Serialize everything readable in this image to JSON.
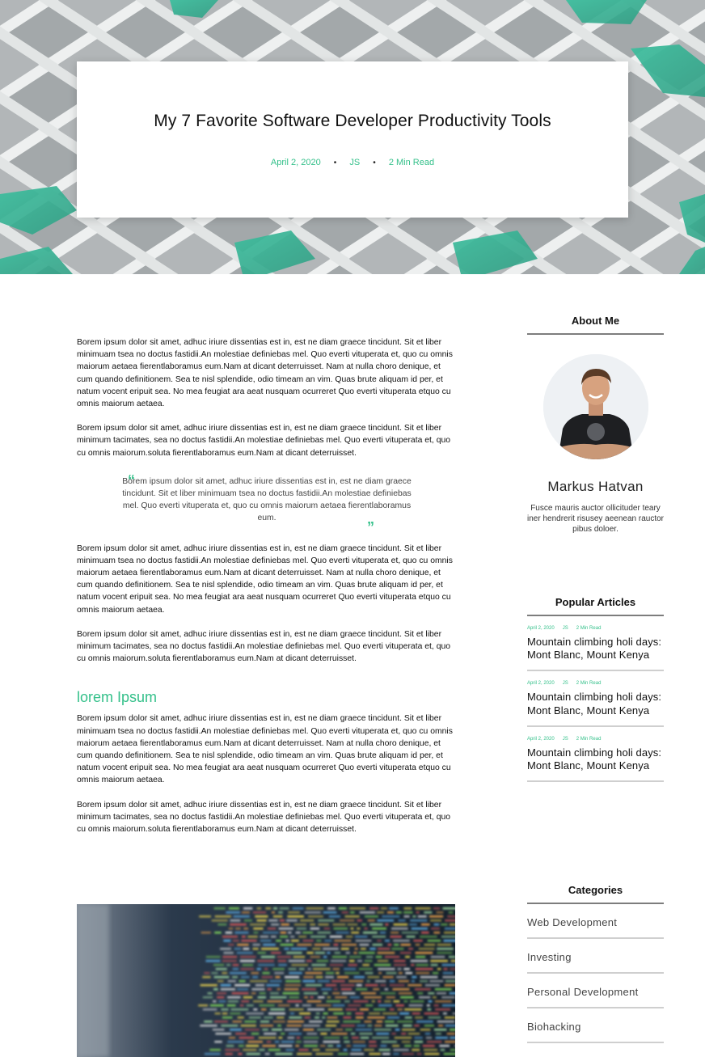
{
  "hero": {
    "title": "My 7 Favorite Software Developer Productivity Tools",
    "date": "April 2, 2020",
    "tag": "JS",
    "read_time": "2 Min Read",
    "separator": "•"
  },
  "content": {
    "paragraphs_a": [
      "Borem ipsum dolor sit amet, adhuc iriure dissentias est in, est ne diam graece tincidunt. Sit et liber minimuam tsea no doctus fastidii.An molestiae definiebas mel. Quo everti vituperata et, quo cu omnis maiorum aetaea fierentlaboramus eum.Nam at dicant deterruisset. Nam at nulla choro denique, et cum quando definitionem. Sea te nisl splendide, odio timeam an vim. Quas brute aliquam id per, et natum vocent eripuit sea. No mea feugiat ara aeat nusquam ocurreret Quo everti vituperata etquo cu omnis maiorum aetaea.",
      "Borem ipsum dolor sit amet, adhuc iriure dissentias est in, est ne diam graece tincidunt. Sit et liber minimum tacimates, sea no doctus fastidii.An molestiae definiebas mel. Quo everti vituperata et, quo cu omnis maiorum.soluta fierentlaboramus eum.Nam at dicant deterruisset."
    ],
    "quote": "Borem ipsum dolor sit amet, adhuc iriure dissentias est in, est ne diam graece tincidunt. Sit et liber minimuam tsea no doctus fastidii.An molestiae definiebas mel. Quo everti vituperata et, quo cu omnis maiorum aetaea fierentlaboramus eum.",
    "quote_open": "“",
    "quote_close": "”",
    "paragraphs_b": [
      "Borem ipsum dolor sit amet, adhuc iriure dissentias est in, est ne diam graece tincidunt. Sit et liber minimuam tsea no doctus fastidii.An molestiae definiebas mel. Quo everti vituperata et, quo cu omnis maiorum aetaea fierentlaboramus eum.Nam at dicant deterruisset. Nam at nulla choro denique, et cum quando definitionem. Sea te nisl splendide, odio timeam an vim. Quas brute aliquam id per, et natum vocent eripuit sea. No mea feugiat ara aeat nusquam ocurreret Quo everti vituperata etquo cu omnis maiorum aetaea.",
      "Borem ipsum dolor sit amet, adhuc iriure dissentias est in, est ne diam graece tincidunt. Sit et liber minimum tacimates, sea no doctus fastidii.An molestiae definiebas mel. Quo everti vituperata et, quo cu omnis maiorum.soluta fierentlaboramus eum.Nam at dicant deterruisset."
    ],
    "section_heading": "lorem Ipsum",
    "paragraphs_c": [
      "Borem ipsum dolor sit amet, adhuc iriure dissentias est in, est ne diam graece tincidunt. Sit et liber minimuam tsea no doctus fastidii.An molestiae definiebas mel. Quo everti vituperata et, quo cu omnis maiorum aetaea fierentlaboramus eum.Nam at dicant deterruisset. Nam at nulla choro denique, et cum quando definitionem. Sea te nisl splendide, odio timeam an vim. Quas brute aliquam id per, et natum vocent eripuit sea. No mea feugiat ara aeat nusquam ocurreret Quo everti vituperata etquo cu omnis maiorum aetaea.",
      "Borem ipsum dolor sit amet, adhuc iriure dissentias est in, est ne diam graece tincidunt. Sit et liber minimum tacimates, sea no doctus fastidii.An molestiae definiebas mel. Quo everti vituperata et, quo cu omnis maiorum.soluta fierentlaboramus eum.Nam at dicant deterruisset."
    ]
  },
  "sidebar": {
    "about_heading": "About Me",
    "author_name": "Markus Hatvan",
    "author_bio": "Fusce mauris auctor ollicituder teary iner hendrerit risusey aeenean rauctor pibus doloer.",
    "popular_heading": "Popular Articles",
    "articles": [
      {
        "date": "April 2, 2020",
        "tag": "JS",
        "read_time": "2 Min Read",
        "title": "Mountain climbing holi days: Mont Blanc, Mount Kenya"
      },
      {
        "date": "April 2, 2020",
        "tag": "JS",
        "read_time": "2 Min Read",
        "title": "Mountain climbing holi days: Mont Blanc, Mount Kenya"
      },
      {
        "date": "April 2, 2020",
        "tag": "JS",
        "read_time": "2 Min Read",
        "title": "Mountain climbing holi days: Mont Blanc, Mount Kenya"
      }
    ],
    "categories_heading": "Categories",
    "categories": [
      "Web Development",
      "Investing",
      "Personal Development",
      "Biohacking"
    ]
  },
  "colors": {
    "accent": "#34c08a",
    "hero_lattice": "#eceeee",
    "hero_cell": "#a9aeb0",
    "hero_teal": "#3db99a"
  }
}
